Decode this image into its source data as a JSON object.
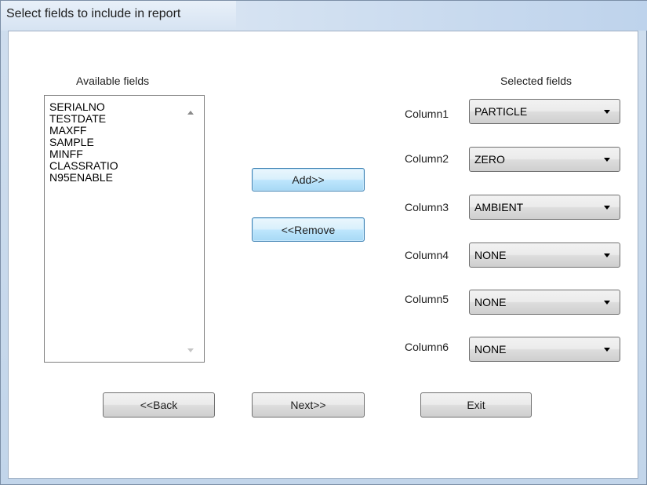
{
  "window": {
    "title": "Select fields to include in report"
  },
  "available": {
    "label": "Available fields",
    "items": [
      "SERIALNO",
      "TESTDATE",
      "MAXFF",
      "SAMPLE",
      "MINFF",
      "CLASSRATIO",
      "N95ENABLE"
    ]
  },
  "buttons": {
    "add": "Add>>",
    "remove": "<<Remove",
    "back": "<<Back",
    "next": "Next>>",
    "exit": "Exit"
  },
  "selected": {
    "label": "Selected fields",
    "columns": [
      {
        "label": "Column1",
        "value": "PARTICLE"
      },
      {
        "label": "Column2",
        "value": "ZERO"
      },
      {
        "label": "Column3",
        "value": "AMBIENT"
      },
      {
        "label": "Column4",
        "value": "NONE"
      },
      {
        "label": "Column5",
        "value": "NONE"
      },
      {
        "label": "Column6",
        "value": "NONE"
      }
    ]
  }
}
